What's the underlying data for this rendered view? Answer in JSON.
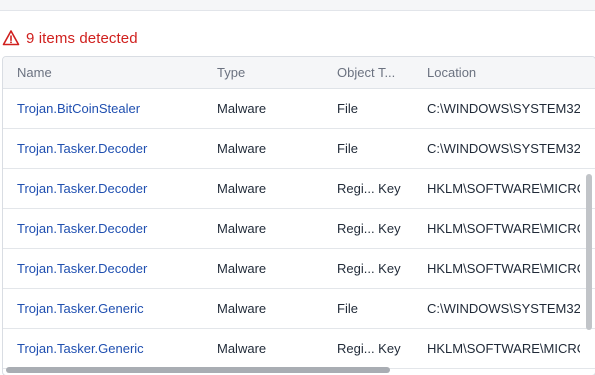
{
  "alert": {
    "icon": "warning-triangle-icon",
    "text": "9 items detected",
    "color": "#d0201e"
  },
  "table": {
    "columns": {
      "name": "Name",
      "type": "Type",
      "object_type": "Object T...",
      "location": "Location"
    },
    "rows": [
      {
        "name": "Trojan.BitCoinStealer",
        "type": "Malware",
        "object_type": "File",
        "location": "C:\\WINDOWS\\SYSTEM32"
      },
      {
        "name": "Trojan.Tasker.Decoder",
        "type": "Malware",
        "object_type": "File",
        "location": "C:\\WINDOWS\\SYSTEM32"
      },
      {
        "name": "Trojan.Tasker.Decoder",
        "type": "Malware",
        "object_type": "Regi... Key",
        "location": "HKLM\\SOFTWARE\\MICRO"
      },
      {
        "name": "Trojan.Tasker.Decoder",
        "type": "Malware",
        "object_type": "Regi... Key",
        "location": "HKLM\\SOFTWARE\\MICRO"
      },
      {
        "name": "Trojan.Tasker.Decoder",
        "type": "Malware",
        "object_type": "Regi... Key",
        "location": "HKLM\\SOFTWARE\\MICRO"
      },
      {
        "name": "Trojan.Tasker.Generic",
        "type": "Malware",
        "object_type": "File",
        "location": "C:\\WINDOWS\\SYSTEM32"
      },
      {
        "name": "Trojan.Tasker.Generic",
        "type": "Malware",
        "object_type": "Regi... Key",
        "location": "HKLM\\SOFTWARE\\MICRO"
      }
    ]
  },
  "colors": {
    "link": "#1f4fb0",
    "header_bg": "#f5f6f8",
    "scrollbar": "#c1c4c8"
  }
}
